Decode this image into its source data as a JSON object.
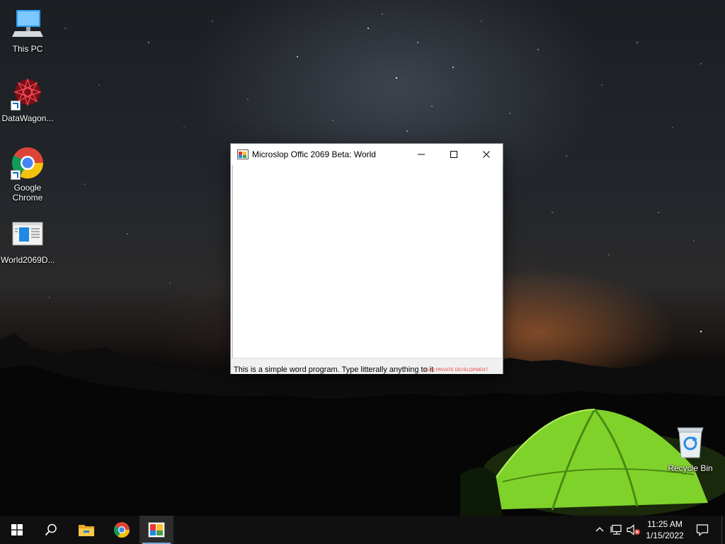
{
  "desktop": {
    "icons": [
      {
        "label": "This PC",
        "icon": "computer-icon"
      },
      {
        "label": "DataWagon...",
        "icon": "datawagon-icon"
      },
      {
        "label": "Google Chrome",
        "icon": "chrome-icon"
      },
      {
        "label": "World2069D...",
        "icon": "document-app-icon"
      },
      {
        "label": "Recycle Bin",
        "icon": "recycle-bin-icon"
      }
    ]
  },
  "window": {
    "title": "Microslop Offic 2069 Beta: World",
    "editor_value": "",
    "status_text": "This is a simple word program. Type litterally anything to it",
    "status_dev_text": "IS IN PRIVATE DEVELOPMENT",
    "colors": {
      "dev_text": "#e53935"
    }
  },
  "taskbar": {
    "items": [
      "start-icon",
      "search-icon",
      "file-explorer-icon",
      "chrome-icon",
      "world-app-icon"
    ],
    "clock": {
      "time": "11:25 AM",
      "date": "1/15/2022"
    }
  }
}
